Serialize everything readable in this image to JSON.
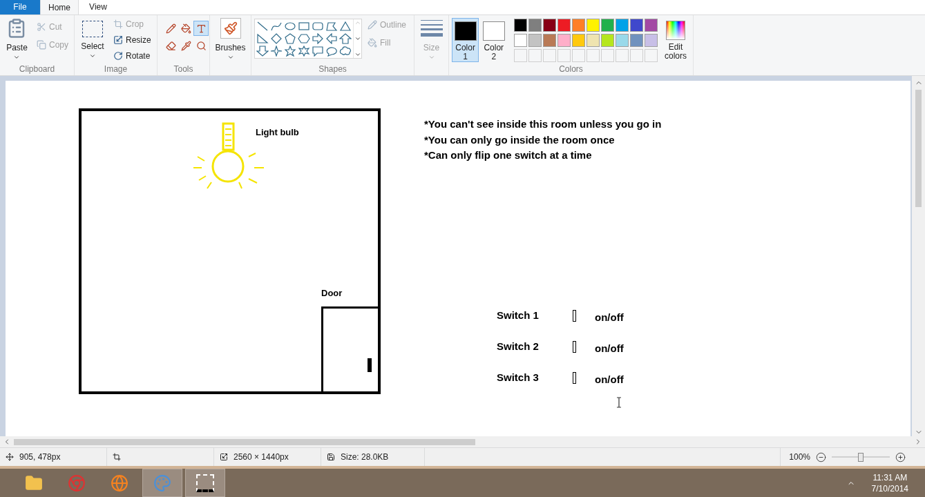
{
  "tabs": [
    {
      "label": "File",
      "kind": "file",
      "selected": false
    },
    {
      "label": "Home",
      "kind": "tab",
      "selected": true
    },
    {
      "label": "View",
      "kind": "tab",
      "selected": false
    }
  ],
  "clipboard": {
    "title": "Clipboard",
    "paste": "Paste",
    "cut": {
      "label": "Cut",
      "disabled": true
    },
    "copy": {
      "label": "Copy",
      "disabled": true
    }
  },
  "image": {
    "title": "Image",
    "select": "Select",
    "crop": {
      "label": "Crop",
      "disabled": true
    },
    "resize": {
      "label": "Resize",
      "disabled": false
    },
    "rotate": {
      "label": "Rotate",
      "disabled": false
    }
  },
  "tools": {
    "title": "Tools",
    "items": [
      {
        "kind": "pencil",
        "selected": false
      },
      {
        "kind": "fill",
        "selected": false
      },
      {
        "kind": "text",
        "selected": true
      },
      {
        "kind": "eraser",
        "selected": false
      },
      {
        "kind": "picker",
        "selected": false
      },
      {
        "kind": "magnifier",
        "selected": false
      }
    ]
  },
  "brushes": {
    "label": "Brushes"
  },
  "shapes": {
    "title": "Shapes",
    "outline": {
      "label": "Outline",
      "disabled": true
    },
    "fill": {
      "label": "Fill",
      "disabled": true
    }
  },
  "size": {
    "label": "Size",
    "disabled": true
  },
  "colors": {
    "title": "Colors",
    "color1": {
      "label": "Color",
      "number": "1",
      "color": "#000000",
      "selected": true
    },
    "color2": {
      "label": "Color",
      "number": "2",
      "color": "#ffffff",
      "selected": false
    },
    "palette": [
      {
        "color": "#000000"
      },
      {
        "color": "#7f7f7f"
      },
      {
        "color": "#880015"
      },
      {
        "color": "#ed1c24"
      },
      {
        "color": "#ff7f27"
      },
      {
        "color": "#fff200"
      },
      {
        "color": "#22b14c"
      },
      {
        "color": "#00a2e8"
      },
      {
        "color": "#3f48cc"
      },
      {
        "color": "#a349a4"
      },
      {
        "color": "#ffffff"
      },
      {
        "color": "#c3c3c3"
      },
      {
        "color": "#b97a57"
      },
      {
        "color": "#ffaec9"
      },
      {
        "color": "#ffc90e"
      },
      {
        "color": "#efe4b0"
      },
      {
        "color": "#b5e61d"
      },
      {
        "color": "#99d9ea"
      },
      {
        "color": "#7092be"
      },
      {
        "color": "#c8bfe7"
      }
    ],
    "edit": "Edit colors"
  },
  "canvas": {
    "bulb_label": "Light bulb",
    "door_label": "Door",
    "notes": [
      "*You can't see inside this room unless you go in",
      "*You can only go inside the room once",
      "*Can only flip one switch at a time"
    ],
    "switches": [
      {
        "label": "Switch 1",
        "status": "on/off"
      },
      {
        "label": "Switch 2",
        "status": "on/off"
      },
      {
        "label": "Switch 3",
        "status": "on/off"
      }
    ]
  },
  "status_bar": {
    "position": "905, 478px",
    "dimensions": "2560 × 1440px",
    "file_size": "Size: 28.0KB",
    "zoom": "100%",
    "zoom_slider": {
      "level": 0.5
    }
  },
  "taskbar": {
    "apps": [
      {
        "kind": "folder",
        "selected": false
      },
      {
        "kind": "browser",
        "selected": false
      },
      {
        "kind": "globe",
        "selected": false
      },
      {
        "kind": "paint",
        "selected": true
      },
      {
        "kind": "snip",
        "selected": true
      }
    ],
    "time": "11:31 AM",
    "date": "7/10/2014"
  }
}
